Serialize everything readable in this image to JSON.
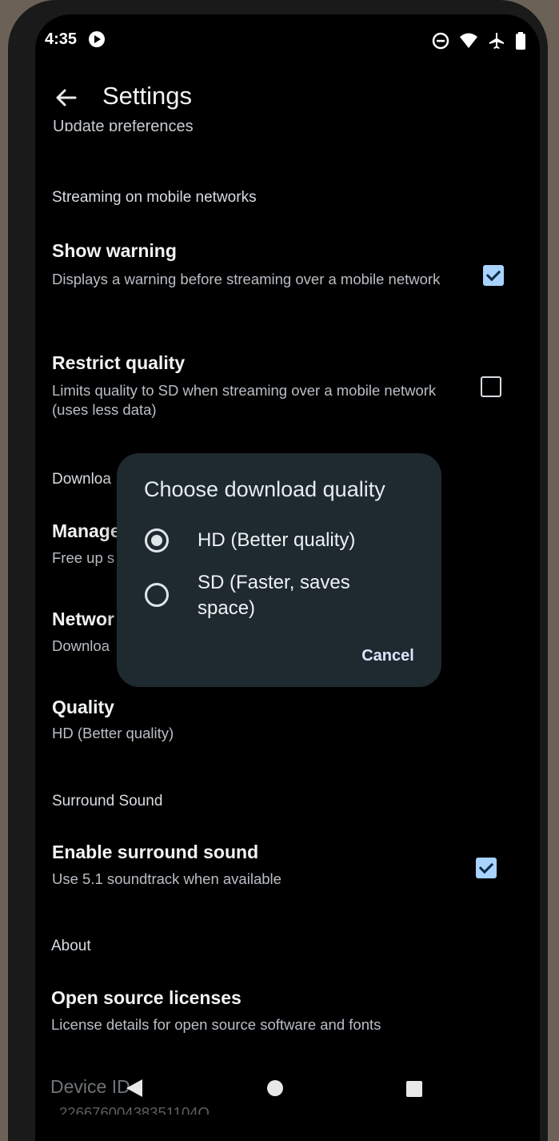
{
  "status_bar": {
    "time": "4:35",
    "icons": [
      "media-icon",
      "do-not-disturb-icon",
      "wifi-icon",
      "airplane-icon",
      "battery-icon"
    ]
  },
  "app_bar": {
    "title": "Settings"
  },
  "cut_off_text": "Update preferences",
  "streaming": {
    "header": "Streaming on mobile networks",
    "show_warning": {
      "title": "Show warning",
      "summary": "Displays a warning before streaming over a mobile network",
      "checked": true
    },
    "restrict_quality": {
      "title": "Restrict quality",
      "summary": "Limits quality to SD when streaming over a mobile network (uses less data)",
      "checked": false
    }
  },
  "downloads": {
    "header_partial": "Downloa",
    "manage": {
      "title_partial": "Manage",
      "summary_partial": "Free up s"
    },
    "network": {
      "title_partial": "Networ",
      "summary_partial": "Downloa"
    },
    "quality": {
      "title": "Quality",
      "summary": "HD (Better quality)"
    }
  },
  "surround": {
    "header": "Surround Sound",
    "enable": {
      "title": "Enable surround sound",
      "summary": "Use 5.1 soundtrack when available",
      "checked": true
    }
  },
  "about": {
    "header": "About",
    "licenses": {
      "title": "Open source licenses",
      "summary": "License details for open source software and fonts"
    },
    "device_id": {
      "title": "Device ID",
      "value": "22667600438351104Q"
    }
  },
  "dialog": {
    "title": "Choose download quality",
    "options": [
      {
        "label": "HD (Better quality)",
        "selected": true
      },
      {
        "label": "SD (Faster, saves space)",
        "selected": false
      }
    ],
    "cancel_label": "Cancel"
  },
  "colors": {
    "background": "#000000",
    "dialog_bg": "#1f2a30",
    "accent": "#a9d3ff"
  }
}
